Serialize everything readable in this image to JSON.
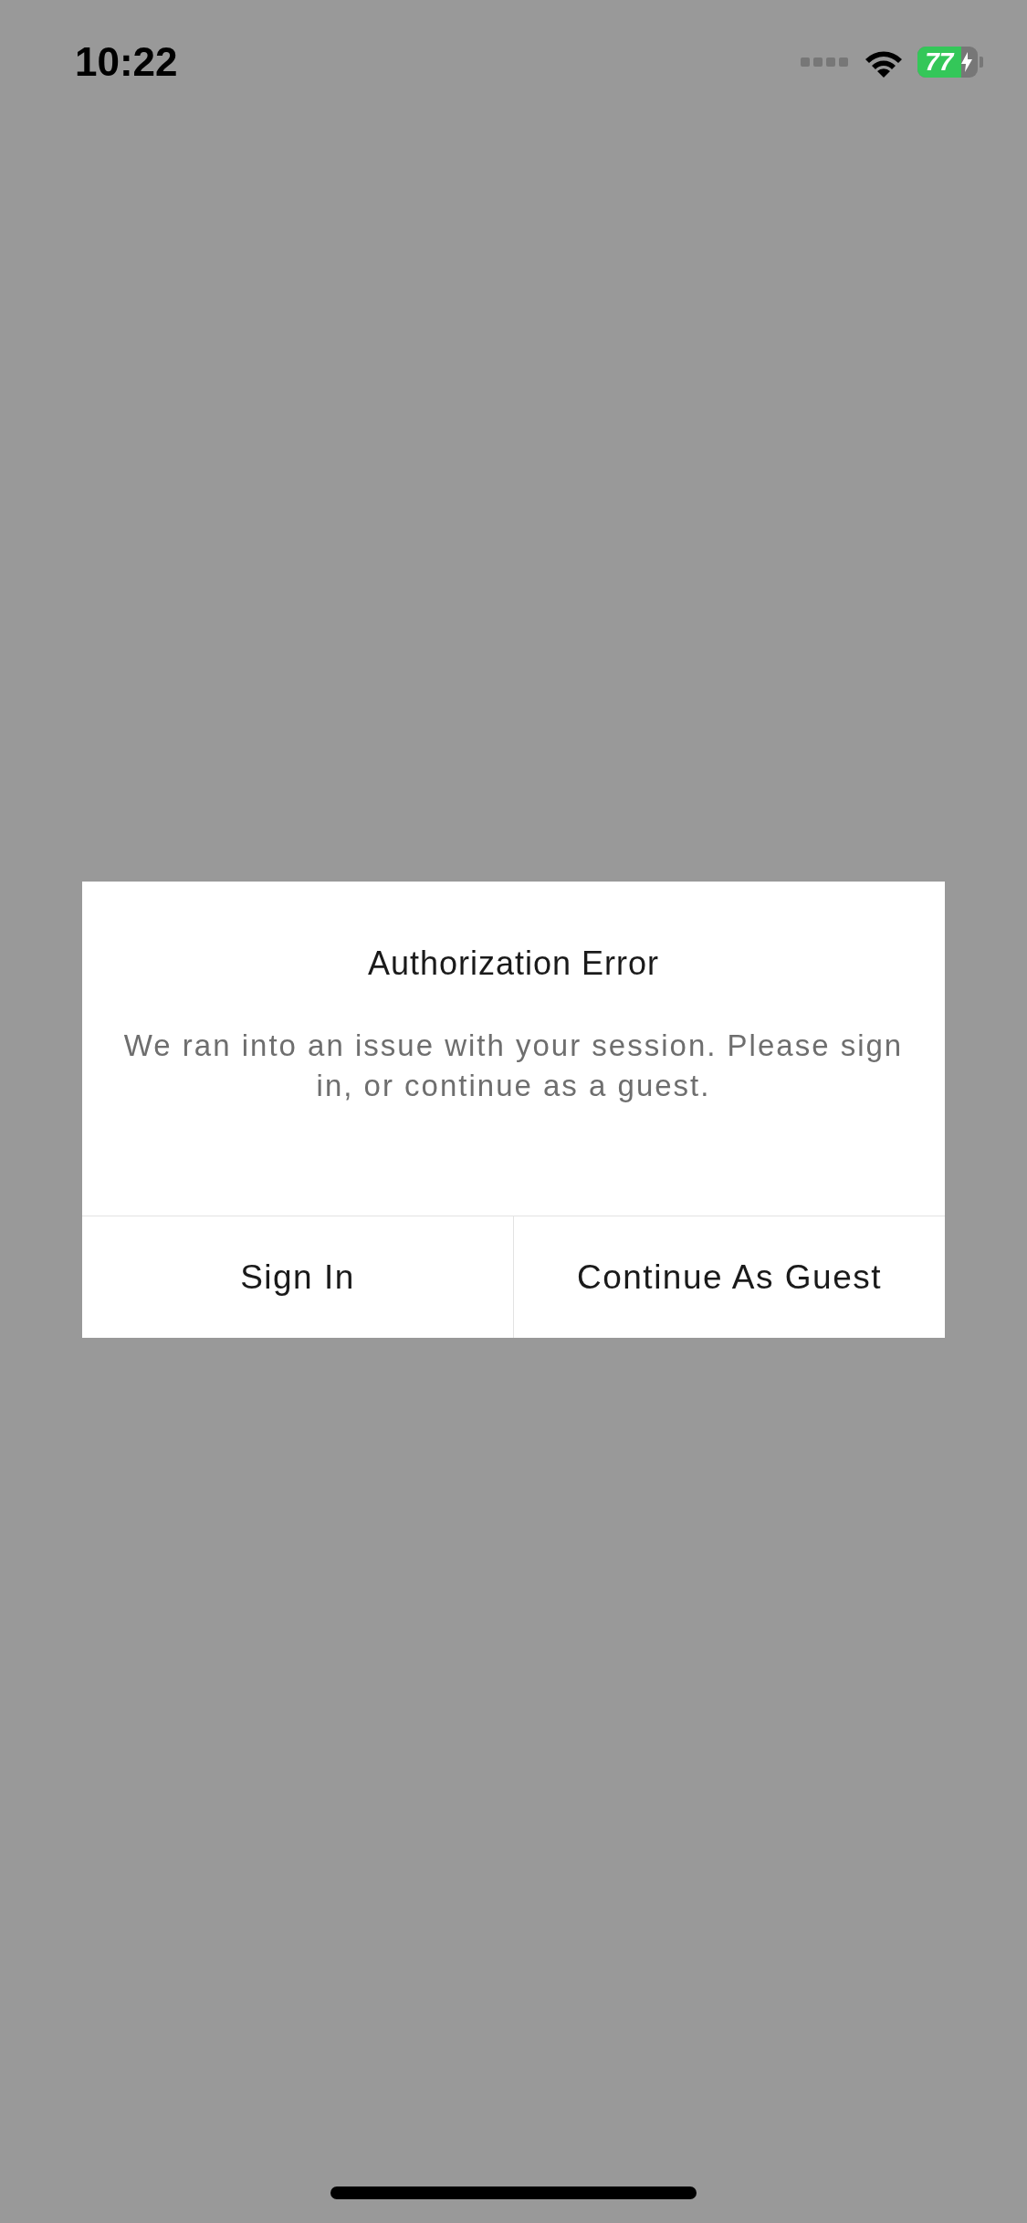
{
  "status_bar": {
    "time": "10:22",
    "battery": "77"
  },
  "dialog": {
    "title": "Authorization Error",
    "message": "We ran into an issue with your session. Please sign in, or continue as a guest.",
    "buttons": [
      {
        "label": "Sign In"
      },
      {
        "label": "Continue As Guest"
      }
    ]
  }
}
